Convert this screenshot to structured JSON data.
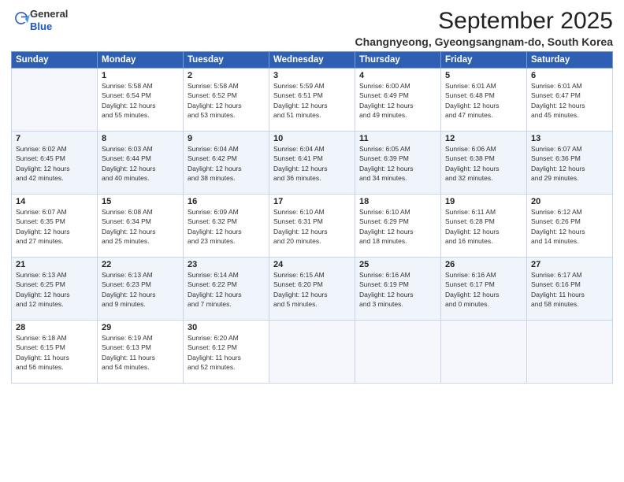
{
  "header": {
    "logo_line1": "General",
    "logo_line2": "Blue",
    "month": "September 2025",
    "location": "Changnyeong, Gyeongsangnam-do, South Korea"
  },
  "days_of_week": [
    "Sunday",
    "Monday",
    "Tuesday",
    "Wednesday",
    "Thursday",
    "Friday",
    "Saturday"
  ],
  "weeks": [
    [
      {
        "day": "",
        "info": ""
      },
      {
        "day": "1",
        "info": "Sunrise: 5:58 AM\nSunset: 6:54 PM\nDaylight: 12 hours\nand 55 minutes."
      },
      {
        "day": "2",
        "info": "Sunrise: 5:58 AM\nSunset: 6:52 PM\nDaylight: 12 hours\nand 53 minutes."
      },
      {
        "day": "3",
        "info": "Sunrise: 5:59 AM\nSunset: 6:51 PM\nDaylight: 12 hours\nand 51 minutes."
      },
      {
        "day": "4",
        "info": "Sunrise: 6:00 AM\nSunset: 6:49 PM\nDaylight: 12 hours\nand 49 minutes."
      },
      {
        "day": "5",
        "info": "Sunrise: 6:01 AM\nSunset: 6:48 PM\nDaylight: 12 hours\nand 47 minutes."
      },
      {
        "day": "6",
        "info": "Sunrise: 6:01 AM\nSunset: 6:47 PM\nDaylight: 12 hours\nand 45 minutes."
      }
    ],
    [
      {
        "day": "7",
        "info": "Sunrise: 6:02 AM\nSunset: 6:45 PM\nDaylight: 12 hours\nand 42 minutes."
      },
      {
        "day": "8",
        "info": "Sunrise: 6:03 AM\nSunset: 6:44 PM\nDaylight: 12 hours\nand 40 minutes."
      },
      {
        "day": "9",
        "info": "Sunrise: 6:04 AM\nSunset: 6:42 PM\nDaylight: 12 hours\nand 38 minutes."
      },
      {
        "day": "10",
        "info": "Sunrise: 6:04 AM\nSunset: 6:41 PM\nDaylight: 12 hours\nand 36 minutes."
      },
      {
        "day": "11",
        "info": "Sunrise: 6:05 AM\nSunset: 6:39 PM\nDaylight: 12 hours\nand 34 minutes."
      },
      {
        "day": "12",
        "info": "Sunrise: 6:06 AM\nSunset: 6:38 PM\nDaylight: 12 hours\nand 32 minutes."
      },
      {
        "day": "13",
        "info": "Sunrise: 6:07 AM\nSunset: 6:36 PM\nDaylight: 12 hours\nand 29 minutes."
      }
    ],
    [
      {
        "day": "14",
        "info": "Sunrise: 6:07 AM\nSunset: 6:35 PM\nDaylight: 12 hours\nand 27 minutes."
      },
      {
        "day": "15",
        "info": "Sunrise: 6:08 AM\nSunset: 6:34 PM\nDaylight: 12 hours\nand 25 minutes."
      },
      {
        "day": "16",
        "info": "Sunrise: 6:09 AM\nSunset: 6:32 PM\nDaylight: 12 hours\nand 23 minutes."
      },
      {
        "day": "17",
        "info": "Sunrise: 6:10 AM\nSunset: 6:31 PM\nDaylight: 12 hours\nand 20 minutes."
      },
      {
        "day": "18",
        "info": "Sunrise: 6:10 AM\nSunset: 6:29 PM\nDaylight: 12 hours\nand 18 minutes."
      },
      {
        "day": "19",
        "info": "Sunrise: 6:11 AM\nSunset: 6:28 PM\nDaylight: 12 hours\nand 16 minutes."
      },
      {
        "day": "20",
        "info": "Sunrise: 6:12 AM\nSunset: 6:26 PM\nDaylight: 12 hours\nand 14 minutes."
      }
    ],
    [
      {
        "day": "21",
        "info": "Sunrise: 6:13 AM\nSunset: 6:25 PM\nDaylight: 12 hours\nand 12 minutes."
      },
      {
        "day": "22",
        "info": "Sunrise: 6:13 AM\nSunset: 6:23 PM\nDaylight: 12 hours\nand 9 minutes."
      },
      {
        "day": "23",
        "info": "Sunrise: 6:14 AM\nSunset: 6:22 PM\nDaylight: 12 hours\nand 7 minutes."
      },
      {
        "day": "24",
        "info": "Sunrise: 6:15 AM\nSunset: 6:20 PM\nDaylight: 12 hours\nand 5 minutes."
      },
      {
        "day": "25",
        "info": "Sunrise: 6:16 AM\nSunset: 6:19 PM\nDaylight: 12 hours\nand 3 minutes."
      },
      {
        "day": "26",
        "info": "Sunrise: 6:16 AM\nSunset: 6:17 PM\nDaylight: 12 hours\nand 0 minutes."
      },
      {
        "day": "27",
        "info": "Sunrise: 6:17 AM\nSunset: 6:16 PM\nDaylight: 11 hours\nand 58 minutes."
      }
    ],
    [
      {
        "day": "28",
        "info": "Sunrise: 6:18 AM\nSunset: 6:15 PM\nDaylight: 11 hours\nand 56 minutes."
      },
      {
        "day": "29",
        "info": "Sunrise: 6:19 AM\nSunset: 6:13 PM\nDaylight: 11 hours\nand 54 minutes."
      },
      {
        "day": "30",
        "info": "Sunrise: 6:20 AM\nSunset: 6:12 PM\nDaylight: 11 hours\nand 52 minutes."
      },
      {
        "day": "",
        "info": ""
      },
      {
        "day": "",
        "info": ""
      },
      {
        "day": "",
        "info": ""
      },
      {
        "day": "",
        "info": ""
      }
    ]
  ]
}
